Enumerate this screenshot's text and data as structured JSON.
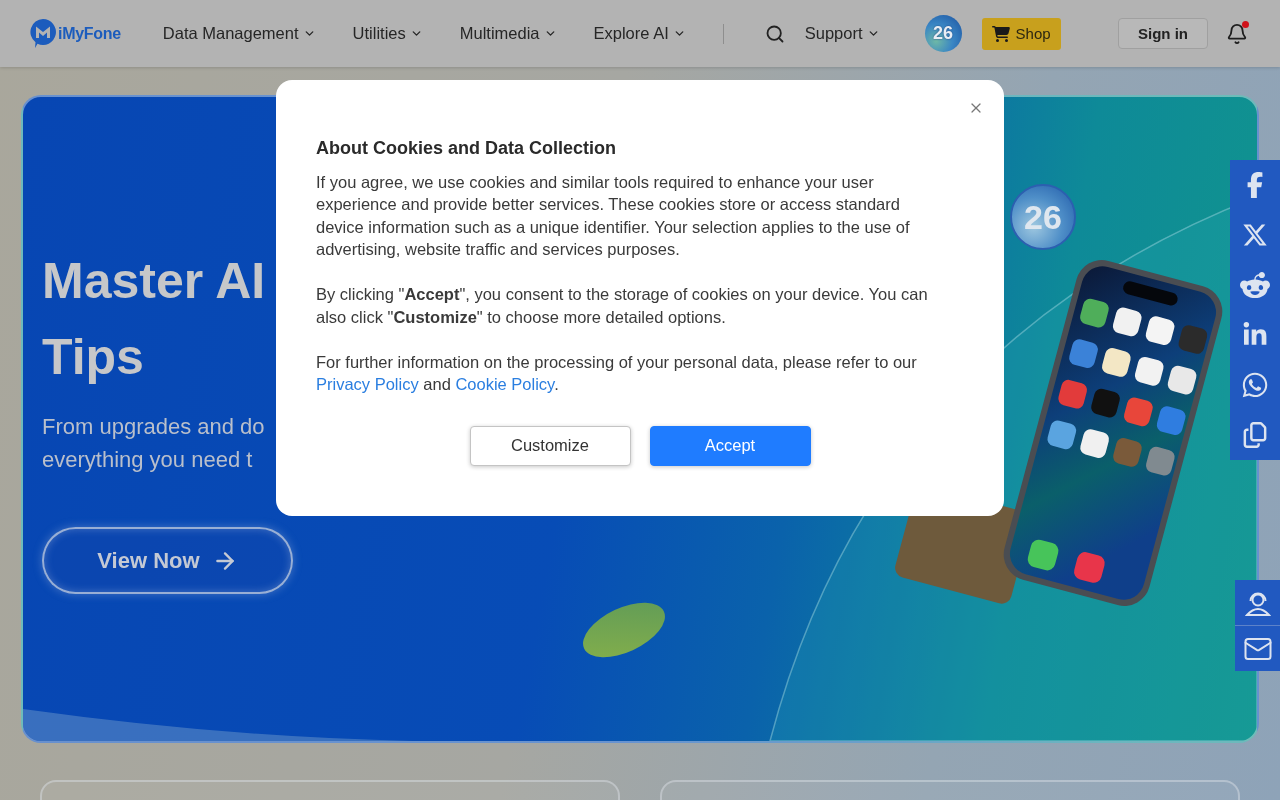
{
  "header": {
    "logo": "iMyFone",
    "nav": [
      {
        "label": "Data Management"
      },
      {
        "label": "Utilities"
      },
      {
        "label": "Multimedia"
      },
      {
        "label": "Explore AI"
      }
    ],
    "support": "Support",
    "badge": "26",
    "shop": "Shop",
    "sign_in": "Sign in",
    "notifications": {
      "unread": true
    }
  },
  "hero": {
    "title_lines": [
      "Master AI",
      "Tips"
    ],
    "subtitle_lines": [
      "From upgrades and do",
      "everything you need t"
    ],
    "button": "View Now",
    "badge": "26"
  },
  "cookie_dialog": {
    "title": "About Cookies and Data Collection",
    "paragraphs": [
      {
        "segments": [
          {
            "kind": "text",
            "text": "If you agree, we use cookies and similar tools required to enhance your user experience and provide better services. These cookies store or access standard device information such as a unique identifier. Your selection applies to the use of advertising, website traffic and services purposes."
          }
        ]
      },
      {
        "segments": [
          {
            "kind": "text",
            "text": "By clicking \"**Accept**\", you consent to the storage of cookies on your device. You can also click \"**Customize**\" to choose more detailed options."
          }
        ]
      },
      {
        "segments": [
          {
            "kind": "text",
            "text": "For further information on the processing of your personal data, please refer to our "
          },
          {
            "kind": "link",
            "text": "Privacy Policy"
          },
          {
            "kind": "text",
            "text": " and "
          },
          {
            "kind": "link",
            "text": "Cookie Policy"
          },
          {
            "kind": "text",
            "text": "."
          }
        ]
      }
    ],
    "buttons": [
      {
        "label": "Customize",
        "kind": "secondary"
      },
      {
        "label": "Accept",
        "kind": "primary"
      }
    ]
  }
}
